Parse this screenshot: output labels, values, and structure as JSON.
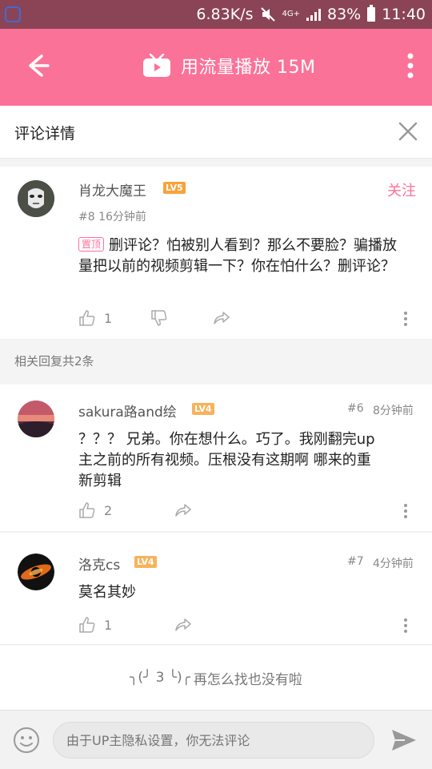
{
  "status": {
    "speed": "6.83K/s",
    "network": "4G+",
    "battery": "83%",
    "time": "11:40"
  },
  "topbar": {
    "title": "用流量播放 15M"
  },
  "subheader": {
    "label": "评论详情"
  },
  "main_comment": {
    "user": "肖龙大魔王",
    "level": "LV5",
    "follow": "关注",
    "meta": "#8   16分钟前",
    "pinned": "置顶",
    "text": "删评论？怕被别人看到？那么不要脸？骗播放量把以前的视频剪辑一下？你在怕什么？删评论？",
    "likes": "1"
  },
  "replies_label": "相关回复共2条",
  "replies": [
    {
      "user": "sakura路and绘",
      "level": "LV4",
      "meta_num": "#6",
      "meta_time": "8分钟前",
      "text": "？？？ 兄弟。你在想什么。巧了。我刚翻完up主之前的所有视频。压根没有这期啊 哪来的重新剪辑",
      "likes": "2"
    },
    {
      "user": "洛克cs",
      "level": "LV4",
      "meta_num": "#7",
      "meta_time": "4分钟前",
      "text": "莫名其妙",
      "likes": "1"
    }
  ],
  "end": {
    "face": "╮(╯ 3 ╰)╭",
    "text": "再怎么找也没有啦"
  },
  "composer": {
    "placeholder": "由于UP主隐私设置，你无法评论"
  }
}
